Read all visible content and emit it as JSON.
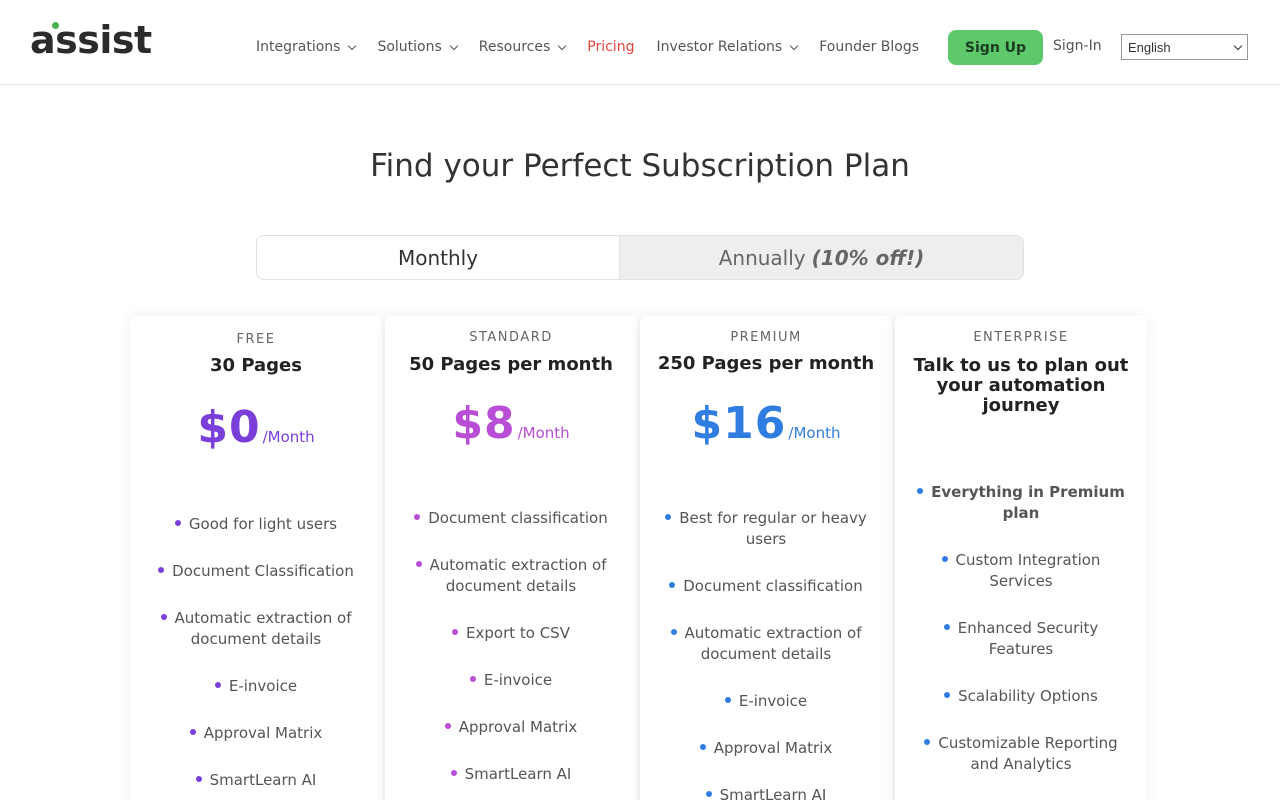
{
  "header": {
    "logo_text": "assist",
    "nav": [
      {
        "label": "Integrations",
        "dropdown": true,
        "active": false
      },
      {
        "label": "Solutions",
        "dropdown": true,
        "active": false
      },
      {
        "label": "Resources",
        "dropdown": true,
        "active": false
      },
      {
        "label": "Pricing",
        "dropdown": false,
        "active": true
      },
      {
        "label": "Investor Relations",
        "dropdown": true,
        "active": false
      },
      {
        "label": "Founder Blogs",
        "dropdown": false,
        "active": false
      }
    ],
    "signup_label": "Sign Up",
    "signin_label": "Sign-In",
    "language": "English"
  },
  "page_title": "Find your Perfect Subscription Plan",
  "billing_toggle": {
    "monthly_label": "Monthly",
    "annual_label": "Annually",
    "annual_discount": "(10% off!)",
    "selected": "monthly"
  },
  "plans": [
    {
      "tier": "FREE",
      "pages": "30 Pages",
      "price": "$0",
      "per": "/Month",
      "color": "#7b3fd9",
      "features": [
        "Good for light users",
        "Document Classification",
        "Automatic extraction of document details",
        "E-invoice",
        "Approval Matrix",
        "SmartLearn AI"
      ]
    },
    {
      "tier": "STANDARD",
      "pages": "50 Pages per month",
      "price": "$8",
      "per": "/Month",
      "color": "#b84ed6",
      "features": [
        "Document classification",
        "Automatic extraction of document details",
        "Export to CSV",
        "E-invoice",
        "Approval Matrix",
        "SmartLearn AI"
      ]
    },
    {
      "tier": "PREMIUM",
      "pages": "250 Pages per month",
      "price": "$16",
      "per": "/Month",
      "color": "#2f7de1",
      "features": [
        "Best for regular or heavy users",
        "Document classification",
        "Automatic extraction of document details",
        "E-invoice",
        "Approval Matrix",
        "SmartLearn AI"
      ]
    },
    {
      "tier": "ENTERPRISE",
      "pages": "Talk to us to plan out your automation journey",
      "price": "",
      "per": "",
      "color": "#2f7de1",
      "features": [
        "Everything in Premium plan",
        "Custom Integration Services",
        "Enhanced Security Features",
        "Scalability Options",
        "Customizable Reporting and Analytics"
      ]
    }
  ]
}
